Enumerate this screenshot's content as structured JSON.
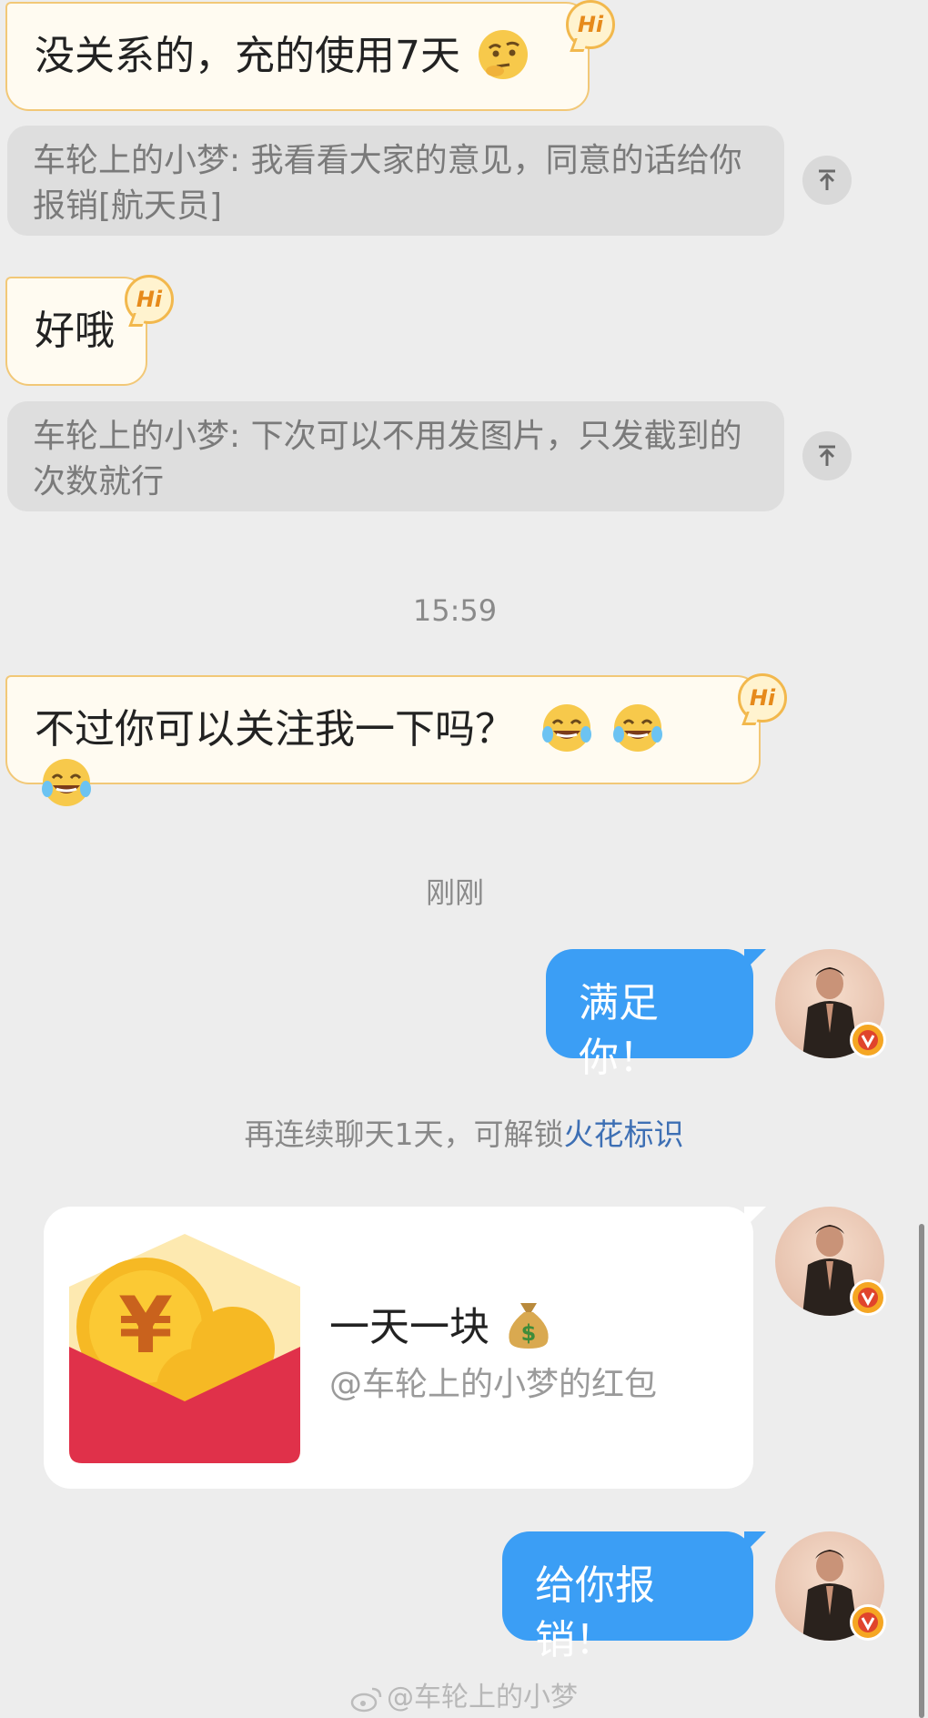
{
  "messages": {
    "m1_text": "没关系的，充的使用7天",
    "hi": "Hi",
    "q1_text": "车轮上的小梦: 我看看大家的意见，同意的话给你报销[航天员]",
    "m2_text": "好哦",
    "q2_text": "车轮上的小梦: 下次可以不用发图片，只发截到的次数就行",
    "ts1": "15:59",
    "m3_text": "不过你可以关注我一下吗？",
    "ts2": "刚刚",
    "out1_text": "满足你！",
    "spark_prefix": "再连续聊天1天，可解锁",
    "spark_link": "火花标识",
    "redpack_title": "一天一块",
    "redpack_sub": "@车轮上的小梦的红包",
    "out2_text": "给你报销！"
  },
  "watermark": "@车轮上的小梦",
  "colors": {
    "background": "#ededed",
    "incoming_bubble": "#fffbf1",
    "incoming_border": "#f2c877",
    "outgoing_bubble": "#3b9ef5",
    "link": "#3d6fb4",
    "redpack_red": "#e0314a"
  },
  "icons": {
    "thinking_emoji": "thinking-face-icon",
    "laugh_emoji": "tears-of-joy-icon",
    "money_bag": "money-bag-icon",
    "scroll_top": "arrow-to-top-icon",
    "verified": "verified-v-badge-icon"
  }
}
